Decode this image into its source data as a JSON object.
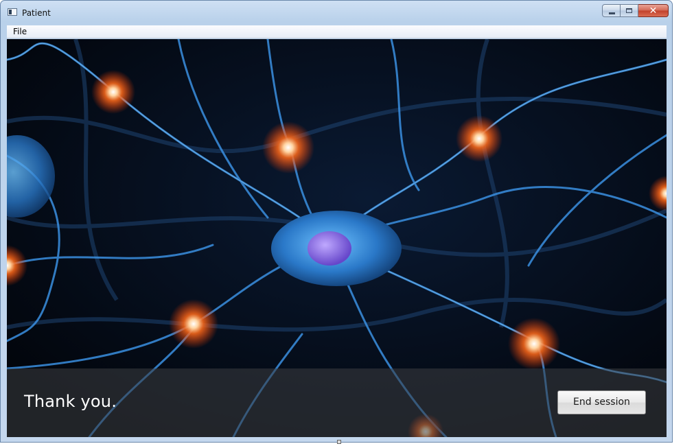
{
  "window": {
    "title": "Patient",
    "icon": "app-window-icon",
    "controls": [
      "minimize-icon",
      "maximize-icon",
      "close-icon"
    ]
  },
  "menu": {
    "items": [
      {
        "label": "File"
      }
    ]
  },
  "content": {
    "background_image": "neuron-network-illustration",
    "message": "Thank you.",
    "end_button_label": "End session"
  },
  "colors": {
    "accent_blue": "#3a8fe0",
    "glow_orange": "#ff6a1a",
    "overlay": "#3c3e42"
  }
}
